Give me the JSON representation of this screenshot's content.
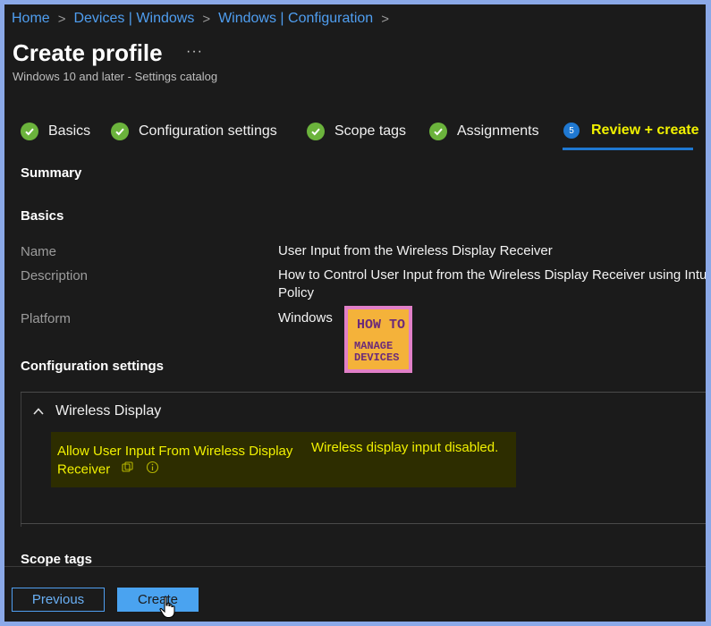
{
  "breadcrumb": {
    "items": [
      "Home",
      "Devices | Windows",
      "Windows | Configuration"
    ]
  },
  "page": {
    "title": "Create profile",
    "more_label": "···",
    "subtitle": "Windows 10 and later - Settings catalog"
  },
  "wizard": {
    "steps": [
      {
        "label": "Basics",
        "state": "complete"
      },
      {
        "label": "Configuration settings",
        "state": "complete"
      },
      {
        "label": "Scope tags",
        "state": "complete"
      },
      {
        "label": "Assignments",
        "state": "complete"
      },
      {
        "label": "Review + create",
        "state": "active",
        "number": "5"
      }
    ]
  },
  "summary": {
    "heading": "Summary",
    "basics": {
      "heading": "Basics",
      "rows": [
        {
          "key": "Name",
          "value": "User Input from the Wireless Display Receiver"
        },
        {
          "key": "Description",
          "value_line1": "How to Control User Input from the Wireless Display Receiver using Intune",
          "value_line2": "Policy"
        },
        {
          "key": "Platform",
          "value": "Windows"
        }
      ]
    },
    "config": {
      "heading": "Configuration settings",
      "category": "Wireless Display",
      "setting_name_line1": "Allow User Input From Wireless Display",
      "setting_name_line2": "Receiver",
      "setting_value": "Wireless display input disabled."
    },
    "scope_tags_heading": "Scope tags"
  },
  "watermark": {
    "line1": "HOW TO",
    "line2": "MANAGE",
    "line3": "DEVICES"
  },
  "footer": {
    "previous_label": "Previous",
    "create_label": "Create"
  },
  "colors": {
    "accent": "#4f9ef0",
    "active_step": "#f1f100",
    "complete": "#6bb33c",
    "highlight_bg": "#2d2d00"
  }
}
